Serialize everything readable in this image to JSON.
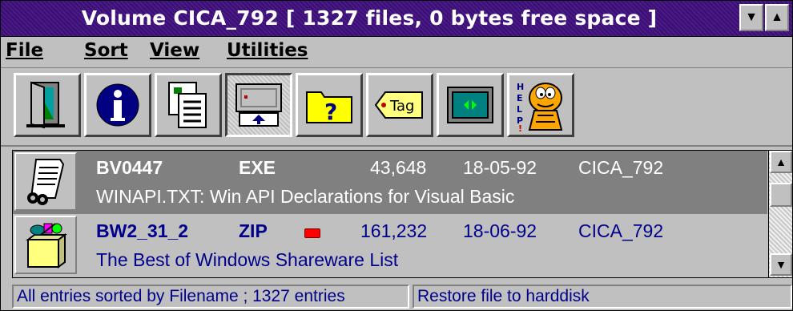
{
  "window": {
    "title": "Volume CICA_792   [ 1327 files, 0 bytes free space ]",
    "colors": {
      "title_bg": "#4a1a86",
      "face": "#c0c0c0",
      "text_blue": "#00008b",
      "selected_bg": "#808080"
    }
  },
  "menu": [
    {
      "label": "File"
    },
    {
      "label": "Sort"
    },
    {
      "label": "View"
    },
    {
      "label": "Utilities"
    }
  ],
  "toolbar": [
    {
      "icon": "exit-door-icon"
    },
    {
      "icon": "info-icon"
    },
    {
      "icon": "file-list-icon"
    },
    {
      "icon": "restore-icon",
      "pressed": true
    },
    {
      "icon": "folder-question-icon",
      "text": "?"
    },
    {
      "icon": "tag-icon",
      "text": "Tag"
    },
    {
      "icon": "monitor-icon"
    },
    {
      "icon": "help-garfield-icon",
      "text": "HELP!"
    }
  ],
  "files": [
    {
      "name": "BV0447",
      "type": "EXE",
      "size": "43,648",
      "date": "18-05-92",
      "volume": "CICA_792",
      "description": "WINAPI.TXT: Win API Declarations for Visual Basic",
      "icon": "text-file-icon",
      "selected": true
    },
    {
      "name": "BW2_31_2",
      "type": "ZIP",
      "size": "161,232",
      "date": "18-06-92",
      "volume": "CICA_792",
      "description": "The Best of Windows Shareware List",
      "icon": "package-icon",
      "selected": false,
      "tag_color": "#ff0000"
    }
  ],
  "status": {
    "left": "All entries sorted by Filename ; 1327 entries",
    "right": "Restore file to harddisk"
  }
}
